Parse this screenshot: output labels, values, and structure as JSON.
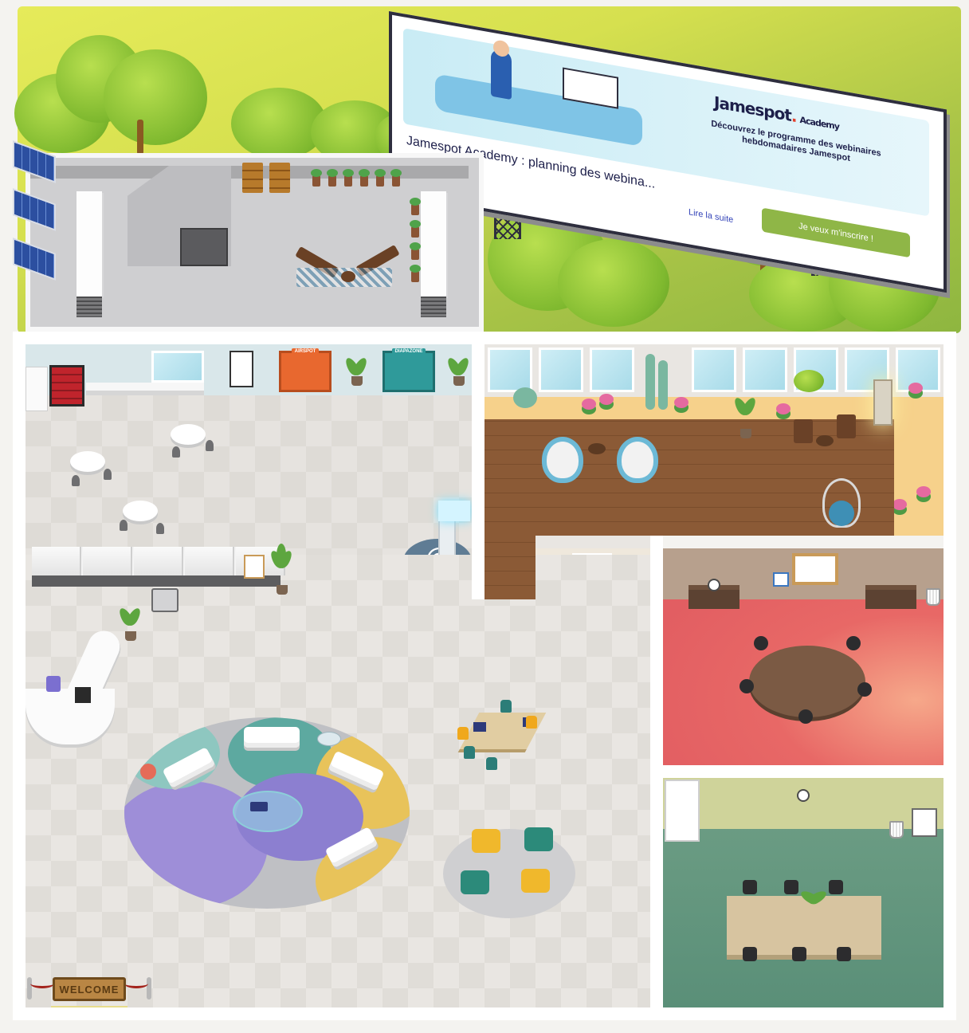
{
  "billboard": {
    "brand": "Jamespot",
    "brand_suffix": "Academy",
    "tagline": "Découvrez le programme des webinaires hebdomadaires Jamespot",
    "title": "Jamespot Academy : planning des webina...",
    "read_more": "Lire la suite",
    "cta": "Je veux m'inscrire !"
  },
  "doors": {
    "airspot": "AIRSPOT",
    "diapazone": "DIAPAZONE"
  },
  "welcome_mat": "WELCOME",
  "colors": {
    "grass": "#d6e04f",
    "floor": "#e9e6e2",
    "deck": "#8b5a36",
    "meeting_red": "#e25e62",
    "meeting_green": "#5a8f78",
    "rug_purple": "#9e8ed8",
    "rug_teal": "#5da9a0",
    "rug_yellow": "#e8c35a",
    "cta_green": "#8fb647",
    "brand_navy": "#1d1f4a",
    "airspot_orange": "#e8682f",
    "diapazone_teal": "#2f9a9a"
  },
  "icons": [
    "solar-panel-icon",
    "beehive-icon",
    "sun-lounger-icon",
    "vending-machine-icon",
    "potted-plant-icon",
    "sofa-icon",
    "armchair-icon",
    "office-chair-icon",
    "clock-icon",
    "waste-bin-icon",
    "whiteboard-icon",
    "bookcase-icon",
    "water-cooler-icon",
    "printer-icon",
    "kiosk-at-icon",
    "lantern-icon",
    "hanging-chair-icon",
    "egg-chair-icon",
    "cactus-icon"
  ]
}
